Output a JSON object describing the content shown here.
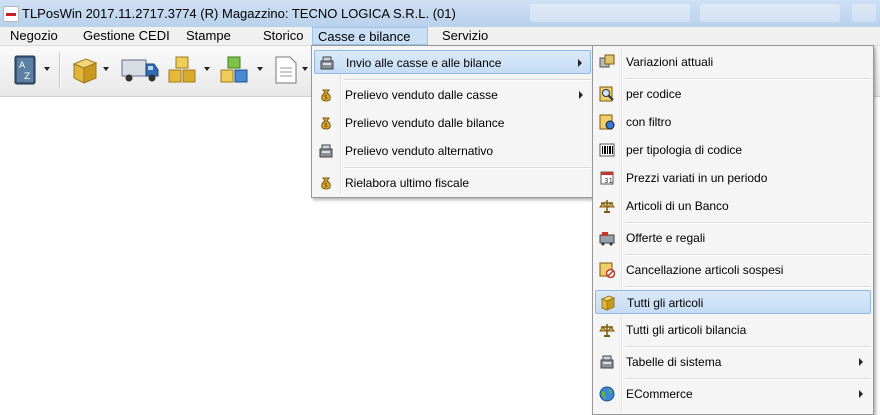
{
  "titlebar": {
    "app_title": "TLPosWin 2017.11.2717.3774 (R)",
    "store": "Magazzino: TECNO LOGICA S.R.L. (01)"
  },
  "menubar": [
    "Negozio",
    "Gestione CEDI",
    "Stampe",
    "Storico",
    "Casse e bilance",
    "Servizio"
  ],
  "menu_casse": {
    "items": [
      {
        "label": "Invio alle casse e alle bilance",
        "icon": "cash-register-icon",
        "submenu": true
      },
      {
        "label": "Prelievo venduto dalle casse",
        "icon": "money-bag-icon",
        "submenu": true
      },
      {
        "label": "Prelievo venduto dalle bilance",
        "icon": "money-bag-icon",
        "submenu": false
      },
      {
        "label": "Prelievo venduto alternativo",
        "icon": "cash-register-icon",
        "submenu": false
      },
      {
        "label": "Rielabora ultimo fiscale",
        "icon": "money-bag-icon",
        "submenu": false
      }
    ]
  },
  "menu_invio": {
    "items": [
      {
        "label": "Variazioni attuali",
        "icon": "variations-icon",
        "submenu": false
      },
      {
        "label": "per codice",
        "icon": "magnifier-icon",
        "submenu": false
      },
      {
        "label": "con filtro",
        "icon": "filter-icon",
        "submenu": false
      },
      {
        "label": "per tipologia di codice",
        "icon": "barcode-icon",
        "submenu": false
      },
      {
        "label": "Prezzi variati in un periodo",
        "icon": "calendar-icon",
        "submenu": false
      },
      {
        "label": "Articoli di un Banco",
        "icon": "scale-icon",
        "submenu": false
      },
      {
        "label": "Offerte e regali",
        "icon": "offers-icon",
        "submenu": false
      },
      {
        "label": "Cancellazione articoli sospesi",
        "icon": "delete-icon",
        "submenu": false
      },
      {
        "label": "Tutti gli articoli",
        "icon": "box-icon",
        "submenu": false
      },
      {
        "label": "Tutti gli articoli bilancia",
        "icon": "scale-icon",
        "submenu": false
      },
      {
        "label": "Tabelle di sistema",
        "icon": "cash-register-icon",
        "submenu": true
      },
      {
        "label": "ECommerce",
        "icon": "globe-icon",
        "submenu": true
      }
    ]
  },
  "colors": {
    "highlight": "#c5dcf5",
    "highlight_border": "#8fb8e5",
    "menu_bg": "#f5f5f5",
    "titlebar": "#c4d8ef"
  }
}
